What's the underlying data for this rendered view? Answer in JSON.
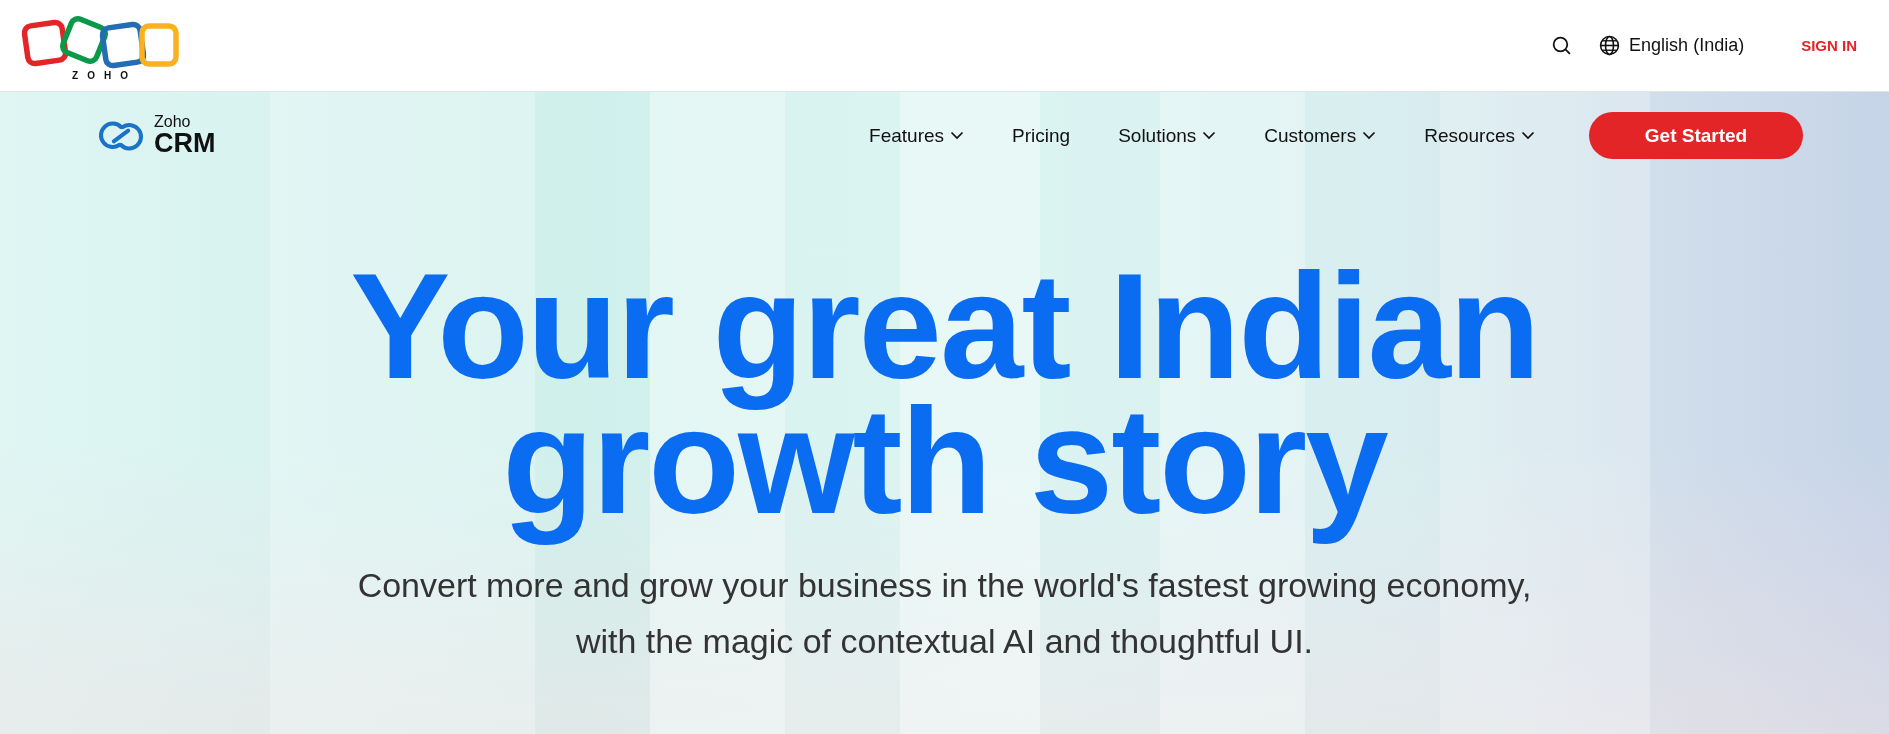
{
  "top_bar": {
    "brand": "ZOHO",
    "language": "English (India)",
    "sign_in": "SIGN IN"
  },
  "nav": {
    "product_small": "Zoho",
    "product_large": "CRM",
    "items": [
      {
        "label": "Features",
        "dropdown": true
      },
      {
        "label": "Pricing",
        "dropdown": false
      },
      {
        "label": "Solutions",
        "dropdown": true
      },
      {
        "label": "Customers",
        "dropdown": true
      },
      {
        "label": "Resources",
        "dropdown": true
      }
    ],
    "cta": "Get Started"
  },
  "hero": {
    "headline": [
      "Your great Indian",
      "growth story"
    ],
    "subtitle": [
      "Convert more and grow your business in the world's fastest growing economy,",
      "with the magic of contextual AI and thoughtful UI."
    ]
  }
}
